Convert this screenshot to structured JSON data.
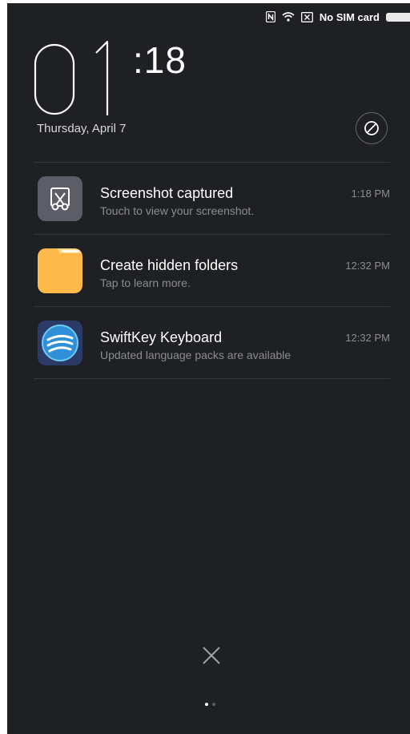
{
  "status_bar": {
    "nfc_icon": "nfc-icon",
    "wifi_icon": "wifi-icon",
    "sim_icon": "no-sim-icon",
    "carrier_text": "No SIM card",
    "battery_icon": "battery-icon"
  },
  "lock_clock": {
    "hours": "01",
    "minutes": ":18",
    "date": "Thursday, April 7"
  },
  "dnd_button": {
    "icon": "do-not-disturb-icon"
  },
  "notifications": [
    {
      "title": "Screenshot captured",
      "subtitle": "Touch to view your screenshot.",
      "time": "1:18 PM",
      "icon": "screenshot-icon",
      "icon_bg": "#5c5d66"
    },
    {
      "title": "Create hidden folders",
      "subtitle": "Tap to learn more.",
      "time": "12:32 PM",
      "icon": "folder-icon",
      "icon_bg": "#ffb84a"
    },
    {
      "title": "SwiftKey Keyboard",
      "subtitle": "Updated language packs are available",
      "time": "12:32 PM",
      "icon": "swiftkey-icon",
      "icon_bg": "#2b3a66"
    }
  ],
  "clear_all": {
    "icon": "close-icon"
  },
  "pager": {
    "pages": 2,
    "current": 1
  },
  "colors": {
    "background": "#1f2023",
    "text_primary": "#ffffff",
    "text_secondary": "#8b8c90"
  }
}
